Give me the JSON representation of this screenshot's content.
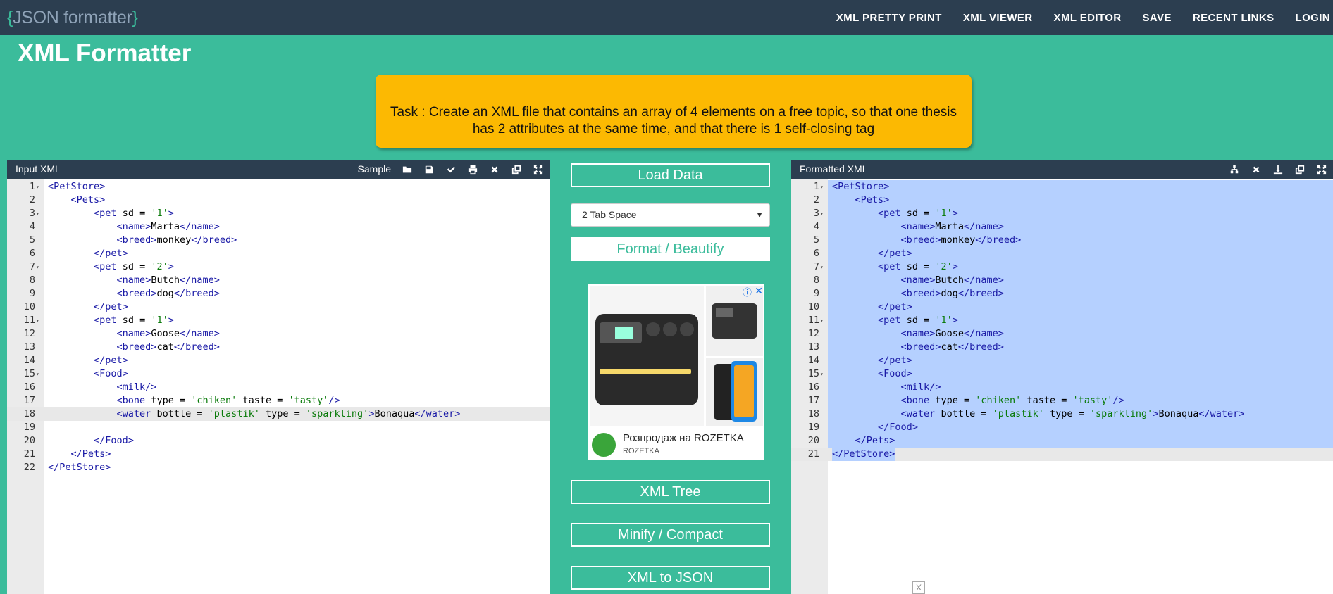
{
  "brand": {
    "open_brace": "{",
    "name": "JSON formatter",
    "close_brace": "}"
  },
  "nav": [
    "XML PRETTY PRINT",
    "XML VIEWER",
    "XML EDITOR",
    "SAVE",
    "RECENT LINKS",
    "LOGIN"
  ],
  "page_title": "XML Formatter",
  "task_text": "Task : Create an XML file that contains an array of 4 elements on a free topic, so that one thesis has 2 attributes at the same time, and that there is 1 self-closing tag",
  "input_panel": {
    "title": "Input XML",
    "sample_label": "Sample",
    "tools": [
      "folder-open-icon",
      "save-icon",
      "check-icon",
      "print-icon",
      "close-icon",
      "copy-icon",
      "expand-icon"
    ],
    "lines": [
      "<PetStore>",
      "    <Pets>",
      "        <pet sd = '1'>",
      "            <name>Marta</name>",
      "            <breed>monkey</breed>",
      "        </pet>",
      "        <pet sd = '2'>",
      "            <name>Butch</name>",
      "            <breed>dog</breed>",
      "        </pet>",
      "        <pet sd = '1'>",
      "            <name>Goose</name>",
      "            <breed>cat</breed>",
      "        </pet>",
      "        <Food>",
      "            <milk/>",
      "            <bone type = 'chiken' taste = 'tasty'/>",
      "            <water bottle = 'plastik' type = 'sparkling'>Bonaqua</water>",
      "",
      "        </Food>",
      "    </Pets>",
      "</PetStore>"
    ],
    "fold_lines": [
      1,
      3,
      7,
      11,
      15
    ],
    "active_line": 18
  },
  "controls": {
    "load_data": "Load Data",
    "indent_option": "2 Tab Space",
    "format": "Format / Beautify",
    "xml_tree": "XML Tree",
    "minify": "Minify / Compact",
    "xml_to_json": "XML to JSON"
  },
  "ad": {
    "title": "Розпродаж на ROZETKA",
    "subtitle": "ROZETKA"
  },
  "output_panel": {
    "title": "Formatted XML",
    "tools": [
      "tree-icon",
      "close-icon",
      "download-icon",
      "copy-icon",
      "expand-icon"
    ],
    "lines": [
      "<PetStore>",
      "    <Pets>",
      "        <pet sd = '1'>",
      "            <name>Marta</name>",
      "            <breed>monkey</breed>",
      "        </pet>",
      "        <pet sd = '2'>",
      "            <name>Butch</name>",
      "            <breed>dog</breed>",
      "        </pet>",
      "        <pet sd = '1'>",
      "            <name>Goose</name>",
      "            <breed>cat</breed>",
      "        </pet>",
      "        <Food>",
      "            <milk/>",
      "            <bone type = 'chiken' taste = 'tasty'/>",
      "            <water bottle = 'plastik' type = 'sparkling'>Bonaqua</water>",
      "        </Food>",
      "    </Pets>",
      "</PetStore>"
    ],
    "fold_lines": [
      1,
      3,
      7,
      11,
      15
    ],
    "active_line": 21
  },
  "colors": {
    "background": "#3bbc9b",
    "navbar": "#2c3e50",
    "task": "#fcb902",
    "selection": "#b5d0ff"
  }
}
